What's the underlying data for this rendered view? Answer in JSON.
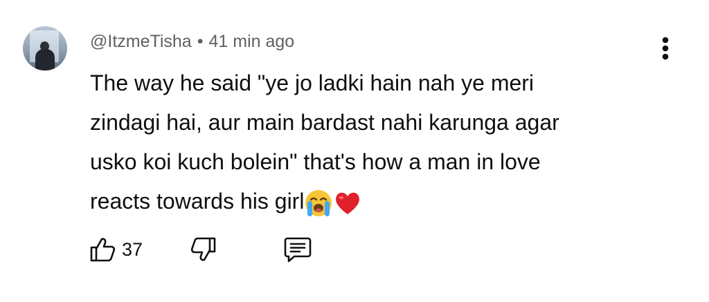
{
  "comment": {
    "author": "@ItzmeTisha",
    "separator": "•",
    "time": "41 min ago",
    "body_lines": [
      "The way he said \"ye jo ladki hain nah ye meri",
      "zindagi hai, aur main bardast nahi karunga agar",
      "usko koi kuch bolein\" that's how a man in love",
      "reacts towards his girl"
    ],
    "emojis": [
      "loudly-crying-face-emoji",
      "red-heart-emoji"
    ],
    "like_count": "37"
  },
  "icons": {
    "menu": "vertical-dots-icon",
    "like": "thumbs-up-icon",
    "dislike": "thumbs-down-icon",
    "reply": "reply-comment-icon"
  },
  "colors": {
    "text_primary": "#0f0f0f",
    "text_secondary": "#606060",
    "heart": "#e0202c",
    "crying_face": "#f7c536",
    "tears": "#3fa9f5"
  }
}
